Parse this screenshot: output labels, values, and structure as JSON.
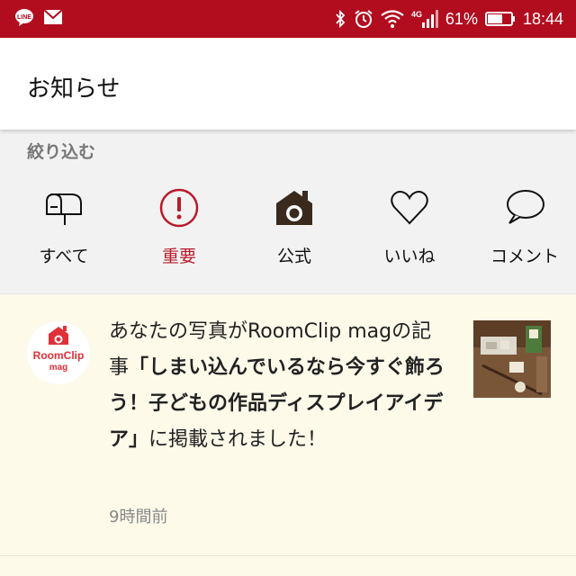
{
  "status_bar": {
    "battery_percent": "61%",
    "time": "18:44",
    "network": "4G",
    "icons": [
      "line-icon",
      "mail-icon",
      "bluetooth-icon",
      "alarm-icon",
      "wifi-icon",
      "signal-icon",
      "battery-icon"
    ]
  },
  "header": {
    "title": "お知らせ"
  },
  "filter": {
    "label": "絞り込む",
    "items": [
      {
        "label": "すべて",
        "icon": "mailbox-icon"
      },
      {
        "label": "重要",
        "icon": "important-icon"
      },
      {
        "label": "公式",
        "icon": "official-house-camera-icon"
      },
      {
        "label": "いいね",
        "icon": "heart-icon"
      },
      {
        "label": "コメント",
        "icon": "comment-icon"
      }
    ],
    "active_color": "#b71c2a"
  },
  "notifications": [
    {
      "avatar_text": "RoomClip",
      "avatar_subtext": "mag",
      "message_prefix": "あなたの写真がRoomClip magの記事",
      "message_title": "「しまい込んでいるなら今すぐ飾ろう！子どもの作品ディスプレイアイデア」",
      "message_suffix": "に掲載されました！",
      "time": "9時間前"
    }
  ],
  "colors": {
    "status_bar": "#b20d1f",
    "accent": "#b71c2a",
    "notification_bg": "#fdfaea",
    "filter_bg": "#f2f2f2"
  }
}
